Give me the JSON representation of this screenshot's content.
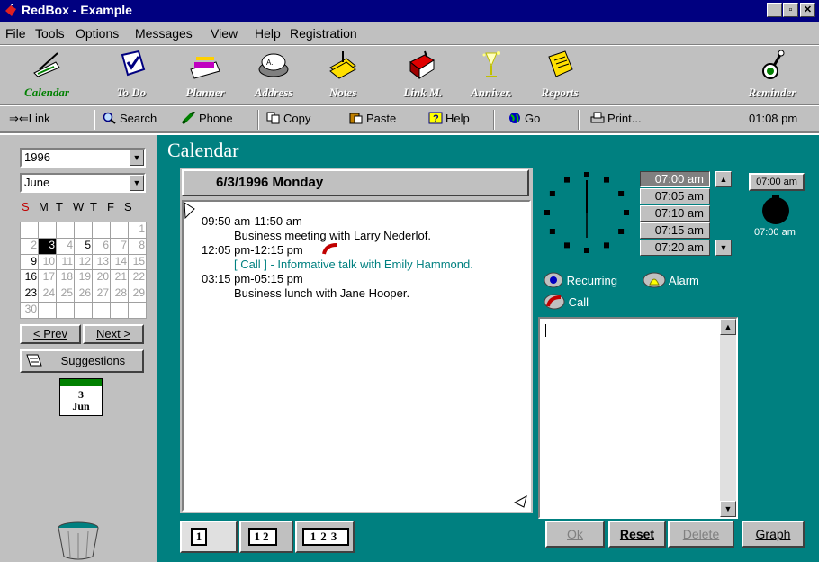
{
  "window": {
    "title": "RedBox - Example",
    "min": "_",
    "max": "т",
    "close": "×"
  },
  "menu": [
    "File",
    "Tools",
    "Options",
    "Messages",
    "View",
    "Help",
    "Registration"
  ],
  "toolbar": [
    {
      "label": "Calendar",
      "icon": "calendar-icon"
    },
    {
      "label": "To Do",
      "icon": "todo-icon"
    },
    {
      "label": "Planner",
      "icon": "planner-icon"
    },
    {
      "label": "Address",
      "icon": "address-icon"
    },
    {
      "label": "Notes",
      "icon": "notes-icon"
    },
    {
      "label": "Link M.",
      "icon": "link-manager-icon"
    },
    {
      "label": "Anniver.",
      "icon": "anniversary-icon"
    },
    {
      "label": "Reports",
      "icon": "reports-icon"
    },
    {
      "label": "Reminder",
      "icon": "reminder-icon"
    }
  ],
  "linkbar": {
    "link": "Link",
    "search": "Search",
    "phone": "Phone",
    "copy": "Copy",
    "paste": "Paste",
    "help": "Help",
    "go": "Go",
    "print": "Print...",
    "time": "01:08 pm"
  },
  "section_title": "Calendar",
  "left": {
    "year": "1996",
    "month": "June",
    "weekdays": [
      "S",
      "M",
      "T",
      "W",
      "T",
      "F",
      "S"
    ],
    "days": [
      [
        "",
        "",
        "",
        "",
        "",
        "",
        "1"
      ],
      [
        "2",
        "3",
        "4",
        "5",
        "6",
        "7",
        "8"
      ],
      [
        "9",
        "10",
        "11",
        "12",
        "13",
        "14",
        "15"
      ],
      [
        "16",
        "17",
        "18",
        "19",
        "20",
        "21",
        "22"
      ],
      [
        "23",
        "24",
        "25",
        "26",
        "27",
        "28",
        "29"
      ],
      [
        "30",
        "",
        "",
        "",
        "",
        "",
        ""
      ]
    ],
    "selected_day": "3",
    "prev": "< Prev",
    "next": "Next >",
    "suggestions": "Suggestions",
    "mini_day": "3",
    "mini_month": "Jun"
  },
  "day": {
    "header": "6/3/1996 Monday",
    "events": [
      {
        "time": "09:50 am-11:50 am",
        "desc": "Business meeting with Larry Nederlof.",
        "call": false
      },
      {
        "time": "12:05 pm-12:15 pm",
        "desc": "[ Call ] - Informative talk with Emily Hammond.",
        "call": true
      },
      {
        "time": "03:15 pm-05:15 pm",
        "desc": "Business lunch with Jane Hooper.",
        "call": false
      }
    ],
    "view_buttons": [
      "1",
      "12",
      "123"
    ]
  },
  "times": [
    "07:00 am",
    "07:05 am",
    "07:10 am",
    "07:15 am",
    "07:20 am"
  ],
  "selected_time": "07:00 am",
  "alarm": {
    "time_button": "07:00 am",
    "time_label": "07:00 am"
  },
  "options": {
    "recurring": "Recurring",
    "alarm": "Alarm",
    "call": "Call"
  },
  "buttons": {
    "ok": "Ok",
    "reset": "Reset",
    "delete": "Delete",
    "graph": "Graph"
  },
  "colors": {
    "titlebar": "#000080",
    "panel": "#c0c0c0",
    "teal": "#008080",
    "call_text": "#008080",
    "sunday": "#c00000"
  }
}
